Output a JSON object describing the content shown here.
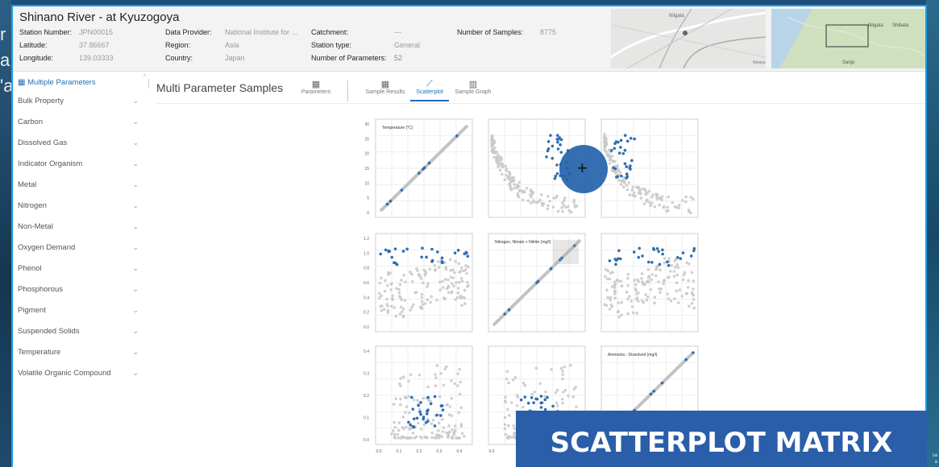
{
  "background": {
    "left_text": [
      "r",
      "a",
      "'a"
    ],
    "right_text": [
      "sa",
      "a"
    ]
  },
  "header": {
    "title": "Shinano River - at Kyuzogoya",
    "station_number_label": "Station Number:",
    "station_number": "JPN00015",
    "latitude_label": "Latitude:",
    "latitude": "37.86667",
    "longitude_label": "Longitude:",
    "longitude": "139.03333",
    "data_provider_label": "Data Provider:",
    "data_provider": "National Institute for ...",
    "region_label": "Region:",
    "region": "Asia",
    "country_label": "Country:",
    "country": "Japan",
    "catchment_label": "Catchment:",
    "catchment": "---",
    "station_type_label": "Station type:",
    "station_type": "General",
    "num_params_label": "Number of Parameters:",
    "num_params": "52",
    "num_samples_label": "Number of Samples:",
    "num_samples": "8775",
    "map1_labels": [
      "Niigata",
      "Ninaya"
    ],
    "map2_labels": [
      "Niigata",
      "Shibata",
      "Sanjo"
    ]
  },
  "sidebar": {
    "heading": "Multiple Parameters",
    "items": [
      "Bulk Property",
      "Carbon",
      "Dissolved Gas",
      "Indicator Organism",
      "Metal",
      "Nitrogen",
      "Non-Metal",
      "Oxygen Demand",
      "Phenol",
      "Phosphorous",
      "Pigment",
      "Suspended Solids",
      "Temperature",
      "Volatile Organic Compound"
    ]
  },
  "main": {
    "title": "Multi Parameter Samples",
    "tabs": [
      {
        "label": "Parameters",
        "icon": "table-icon"
      },
      {
        "label": "Sample Results",
        "icon": "table-icon"
      },
      {
        "label": "Scatterplot",
        "icon": "line-chart-icon"
      },
      {
        "label": "Sample Graph",
        "icon": "bar-chart-icon"
      }
    ],
    "active_tab": "Scatterplot"
  },
  "colors": {
    "accent": "#1f6fb5",
    "point_selected": "#2f6fb0",
    "point_other": "#c8c8c8",
    "banner": "#2a5ea8"
  },
  "chart_data": {
    "type": "scatter",
    "layout": "scatterplot-matrix",
    "variables": [
      "Temperature (°C)",
      "Nitrogen, Nitrate + Nitrite (mg/l)",
      "Ammonia - Dissolved (mg/l)"
    ],
    "axis_ticks": {
      "temperature": [
        "30",
        "25",
        "20",
        "15",
        "10",
        "5",
        "0"
      ],
      "nitrogen": [
        "1.2",
        "1.0",
        "0.8",
        "0.6",
        "0.4",
        "0.2",
        "0.0"
      ],
      "ammonia": [
        "0.4",
        "0.3",
        "0.2",
        "0.1",
        "0.0"
      ],
      "ammonia_x": [
        "0.0",
        "0.1",
        "0.2",
        "0.3",
        "0.4"
      ],
      "col2_x": [
        "0.0"
      ]
    },
    "ranges": {
      "temperature": [
        0,
        30
      ],
      "nitrogen": [
        0,
        1.2
      ],
      "ammonia": [
        0,
        0.45
      ]
    }
  },
  "banner": {
    "text": "SCATTERPLOT MATRIX"
  }
}
